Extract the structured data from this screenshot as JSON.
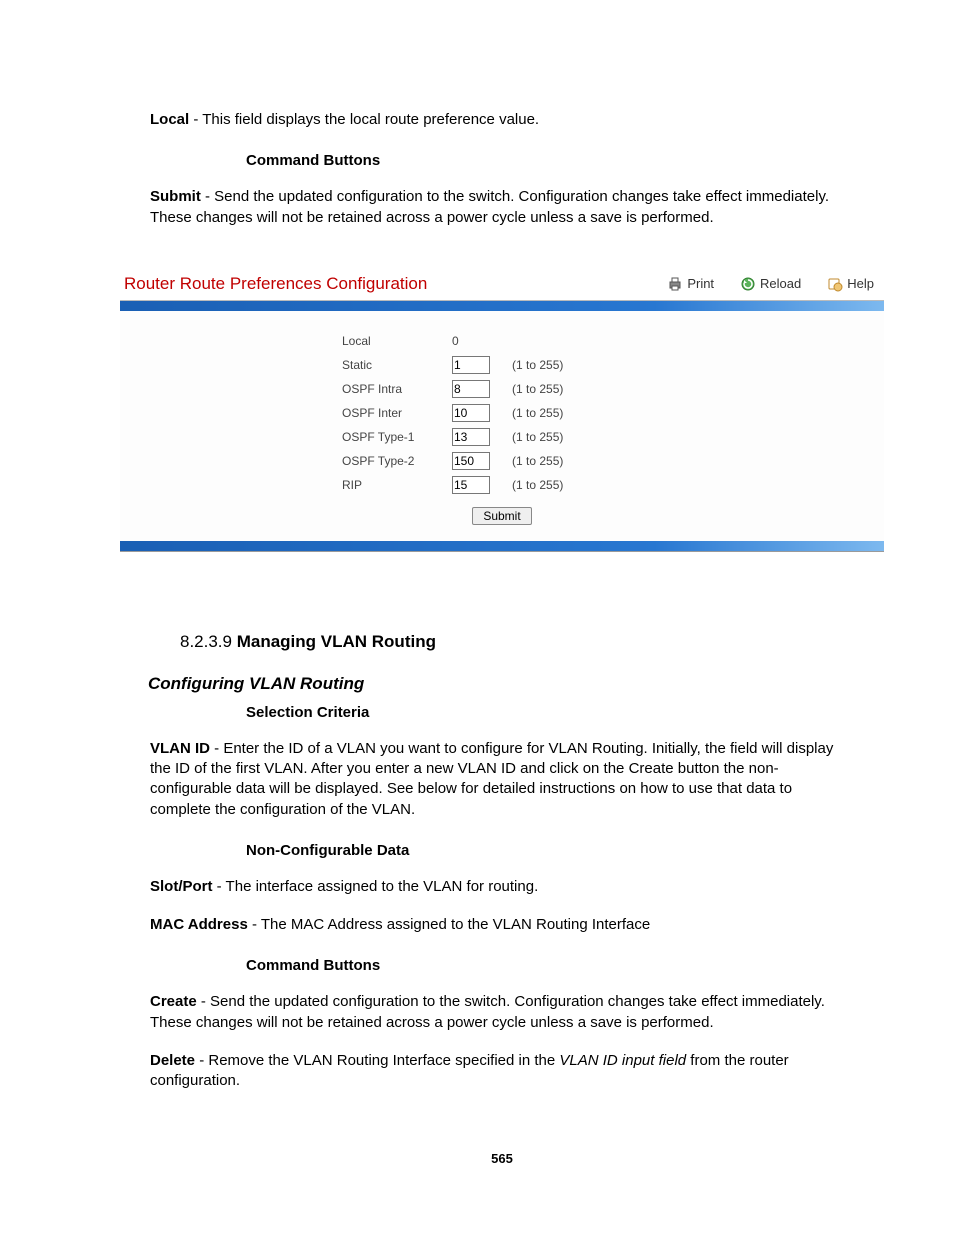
{
  "intro": {
    "local_label": "Local",
    "local_desc": " - This field displays the local route preference value."
  },
  "cmd_btns_head": "Command Buttons",
  "submit_para": {
    "label": "Submit",
    "desc": " - Send the updated configuration to the switch. Configuration changes take effect immediately. These changes will not be retained across a power cycle unless a save is performed."
  },
  "panel": {
    "title": "Router Route Preferences Configuration",
    "print": "Print",
    "reload": "Reload",
    "help": "Help",
    "rows": {
      "local": {
        "label": "Local",
        "value": "0",
        "editable": false
      },
      "static": {
        "label": "Static",
        "value": "1",
        "range": "(1 to 255)"
      },
      "intra": {
        "label": "OSPF Intra",
        "value": "8",
        "range": "(1 to 255)"
      },
      "inter": {
        "label": "OSPF Inter",
        "value": "10",
        "range": "(1 to 255)"
      },
      "t1": {
        "label": "OSPF Type-1",
        "value": "13",
        "range": "(1 to 255)"
      },
      "t2": {
        "label": "OSPF Type-2",
        "value": "150",
        "range": "(1 to 255)"
      },
      "rip": {
        "label": "RIP",
        "value": "15",
        "range": "(1 to 255)"
      }
    },
    "submit": "Submit"
  },
  "sec": {
    "num": "8.2.3.9 ",
    "title": "Managing VLAN Routing"
  },
  "cfg_head": "Configuring VLAN Routing",
  "sel_head": "Selection Criteria",
  "vlan_id": {
    "label": "VLAN ID",
    "desc": " - Enter the ID of a VLAN you want to configure for VLAN Routing. Initially, the field will display the ID of the first VLAN. After you enter a new VLAN ID and click on the Create button the non-configurable data will be displayed. See below for detailed instructions on how to use that data to complete the configuration of the VLAN."
  },
  "ncd_head": "Non-Configurable Data",
  "slot": {
    "label": "Slot/Port",
    "desc": " - The interface assigned to the VLAN for routing."
  },
  "mac": {
    "label": "MAC Address",
    "desc": " - The MAC Address assigned to the VLAN Routing Interface"
  },
  "create": {
    "label": "Create",
    "desc": " - Send the updated configuration to the switch. Configuration changes take effect immediately. These changes will not be retained across a power cycle unless a save is performed."
  },
  "delete": {
    "label": "Delete",
    "pre": " - Remove the VLAN Routing Interface specified in the ",
    "ital": "VLAN ID input field",
    "post": " from the router configuration."
  },
  "page_num": "565"
}
